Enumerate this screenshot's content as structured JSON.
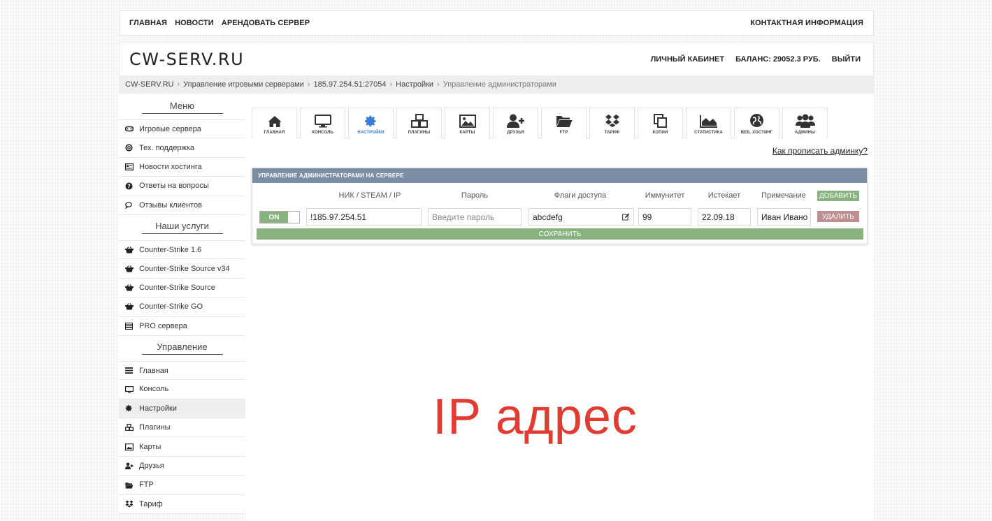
{
  "topnav": {
    "links": [
      "ГЛАВНАЯ",
      "НОВОСТИ",
      "АРЕНДОВАТЬ СЕРВЕР"
    ],
    "contact": "КОНТАКТНАЯ ИНФОРМАЦИЯ"
  },
  "header": {
    "logo": "CW-SERV.RU",
    "cabinet": "ЛИЧНЫЙ КАБИНЕТ",
    "balance": "БАЛАНС: 29052.3 РУБ.",
    "logout": "ВЫЙТИ"
  },
  "breadcrumb": [
    "CW-SERV.RU",
    "Управление игровыми серверами",
    "185.97.254.51:27054",
    "Настройки",
    "Управление администраторами"
  ],
  "sidebar": {
    "menu_title": "Меню",
    "menu_items": [
      {
        "label": "Игровые сервера",
        "icon": "gamepad-icon"
      },
      {
        "label": "Тех. поддержка",
        "icon": "lifebuoy-icon"
      },
      {
        "label": "Новости хостинга",
        "icon": "newspaper-icon"
      },
      {
        "label": "Ответы на вопросы",
        "icon": "question-icon"
      },
      {
        "label": "Отзывы клиентов",
        "icon": "comments-icon"
      }
    ],
    "services_title": "Наши услуги",
    "services_items": [
      {
        "label": "Counter-Strike 1.6",
        "icon": "basket-icon"
      },
      {
        "label": "Counter-Strike Source v34",
        "icon": "basket-icon"
      },
      {
        "label": "Counter-Strike Source",
        "icon": "basket-icon"
      },
      {
        "label": "Counter-Strike GO",
        "icon": "basket-icon"
      },
      {
        "label": "PRO сервера",
        "icon": "server-icon"
      }
    ],
    "manage_title": "Управление",
    "manage_items": [
      {
        "label": "Главная",
        "icon": "bars-icon"
      },
      {
        "label": "Консоль",
        "icon": "monitor-icon"
      },
      {
        "label": "Настройки",
        "icon": "gear-icon"
      },
      {
        "label": "Плагины",
        "icon": "cubes-icon"
      },
      {
        "label": "Карты",
        "icon": "image-icon"
      },
      {
        "label": "Друзья",
        "icon": "user-plus-icon"
      },
      {
        "label": "FTP",
        "icon": "folder-icon"
      },
      {
        "label": "Тариф",
        "icon": "dropbox-icon"
      }
    ]
  },
  "tabs": [
    {
      "label": "ГЛАВНАЯ",
      "icon": "home-icon"
    },
    {
      "label": "КОНСОЛЬ",
      "icon": "monitor-icon"
    },
    {
      "label": "НАСТРОЙКИ",
      "icon": "gear-icon"
    },
    {
      "label": "ПЛАГИНЫ",
      "icon": "cubes-icon"
    },
    {
      "label": "КАРТЫ",
      "icon": "image-icon"
    },
    {
      "label": "ДРУЗЬЯ",
      "icon": "user-plus-icon"
    },
    {
      "label": "FTP",
      "icon": "folder-icon"
    },
    {
      "label": "ТАРИФ",
      "icon": "dropbox-icon"
    },
    {
      "label": "КОПИИ",
      "icon": "copy-icon"
    },
    {
      "label": "СТАТИСТИКА",
      "icon": "area-chart-icon"
    },
    {
      "label": "ВЕБ. ХОСТИНГ",
      "icon": "globe-icon"
    },
    {
      "label": "АДМИНЫ",
      "icon": "users-icon"
    }
  ],
  "howto_link": "Как прописать админку?",
  "panel": {
    "title": "УПРАВЛЕНИЕ АДМИНИСТРАТОРАМИ НА СЕРВЕРЕ",
    "columns": [
      "НИК / STEAM / IP",
      "Пароль",
      "Флаги доступа",
      "Иммунитет",
      "Истекает",
      "Примечание"
    ],
    "add_label": "ДОБАВИТЬ",
    "row": {
      "toggle": "ON",
      "nick": "!185.97.254.51",
      "password_placeholder": "Введите пароль",
      "flags": "abcdefg",
      "immunity": "99",
      "expires": "22.09.18",
      "note": "Иван Ивано",
      "delete_label": "УДАЛИТЬ"
    },
    "save_label": "СОХРАНИТЬ"
  },
  "overlay_text": "IP адрес",
  "colors": {
    "accent_green": "#88b27e",
    "delete_red": "#be8f90",
    "panel_head": "#7b8ea6",
    "active_tab": "#3a7fd5",
    "overlay": "#e03c31"
  }
}
